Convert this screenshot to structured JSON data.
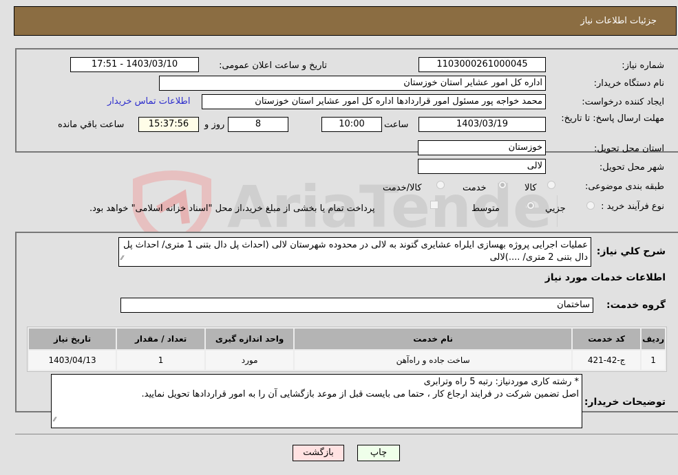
{
  "header": {
    "title": "جزئیات اطلاعات نیاز"
  },
  "form": {
    "need_number": {
      "label": "شماره نیاز:",
      "value": "1103000261000045"
    },
    "announce_datetime": {
      "label": "تاریخ و ساعت اعلان عمومی:",
      "value": "1403/03/10 - 17:51"
    },
    "buyer_org": {
      "label": "نام دستگاه خريدار:",
      "value": "اداره کل امور عشایر استان خوزستان"
    },
    "requester": {
      "label": "ایجاد کننده درخواست:",
      "value": "محمد خواجه پور مسئول امور قراردادها اداره کل امور عشایر استان خوزستان"
    },
    "buyer_contact_link": "اطلاعات تماس خریدار",
    "deadline": {
      "label": "مهلت ارسال پاسخ: تا تاریخ:",
      "date": "1403/03/19",
      "time_label": "ساعت",
      "time": "10:00",
      "days": "8",
      "days_label": "روز و",
      "remaining": "15:37:56",
      "remaining_label": "ساعت باقي مانده"
    },
    "delivery_province": {
      "label": "استان محل تحویل:",
      "value": "خوزستان"
    },
    "delivery_city": {
      "label": "شهر محل تحویل:",
      "value": "لالی"
    },
    "category": {
      "label": "طبقه بندی موضوعی:",
      "options": [
        "کالا",
        "خدمت",
        "کالا/خدمت"
      ],
      "selected": "خدمت"
    },
    "purchase_type": {
      "label": "نوع فرآیند خرید :",
      "options": [
        "جزيي",
        "متوسط"
      ],
      "selected": "متوسط",
      "treasury_checkbox_label": "پرداخت تمام یا بخشی از مبلغ خرید،از محل \"اسناد خزانه اسلامی\" خواهد بود.",
      "treasury_checked": false
    }
  },
  "details": {
    "description_label": "شرح کلي نياز:",
    "description": "عملیات اجرایی پروژه بهسازی ایلراه عشایری گتوند به لالی در محدوده شهرستان لالی (احداث پل دال بتنی 1 متری/ احداث پل دال بتنی 2 متری/ ....)لالی",
    "services_heading": "اطلاعات خدمات مورد نیاز",
    "service_group_label": "گروه خدمت:",
    "service_group": "ساختمان",
    "table": {
      "headers": [
        "ردیف",
        "کد خدمت",
        "نام خدمت",
        "واحد اندازه گیری",
        "تعداد / مقدار",
        "تاریخ نیاز"
      ],
      "rows": [
        [
          "1",
          "ج-42-421",
          "ساخت جاده و راه‌آهن",
          "مورد",
          "1",
          "1403/04/13"
        ]
      ]
    },
    "buyer_notes_label": "توضیحات خریدار:",
    "buyer_notes_line1": "* رشته کاری موردنیاز:   رتبه 5 راه وترابری",
    "buyer_notes_line2": "اصل تضمین شرکت در فرایند ارجاع کار ،   حتما می بایست قبل از موعد بازگشایی  آن را به امور قراردادها تحویل نمایید."
  },
  "buttons": {
    "print": "چاپ",
    "back": "بازگشت"
  },
  "watermark": "AriaTender.neT",
  "colors": {
    "header_bg": "#8b6d42",
    "print_bg": "#efffea",
    "back_bg": "#ffe2e2",
    "link": "#2c2ccc"
  }
}
